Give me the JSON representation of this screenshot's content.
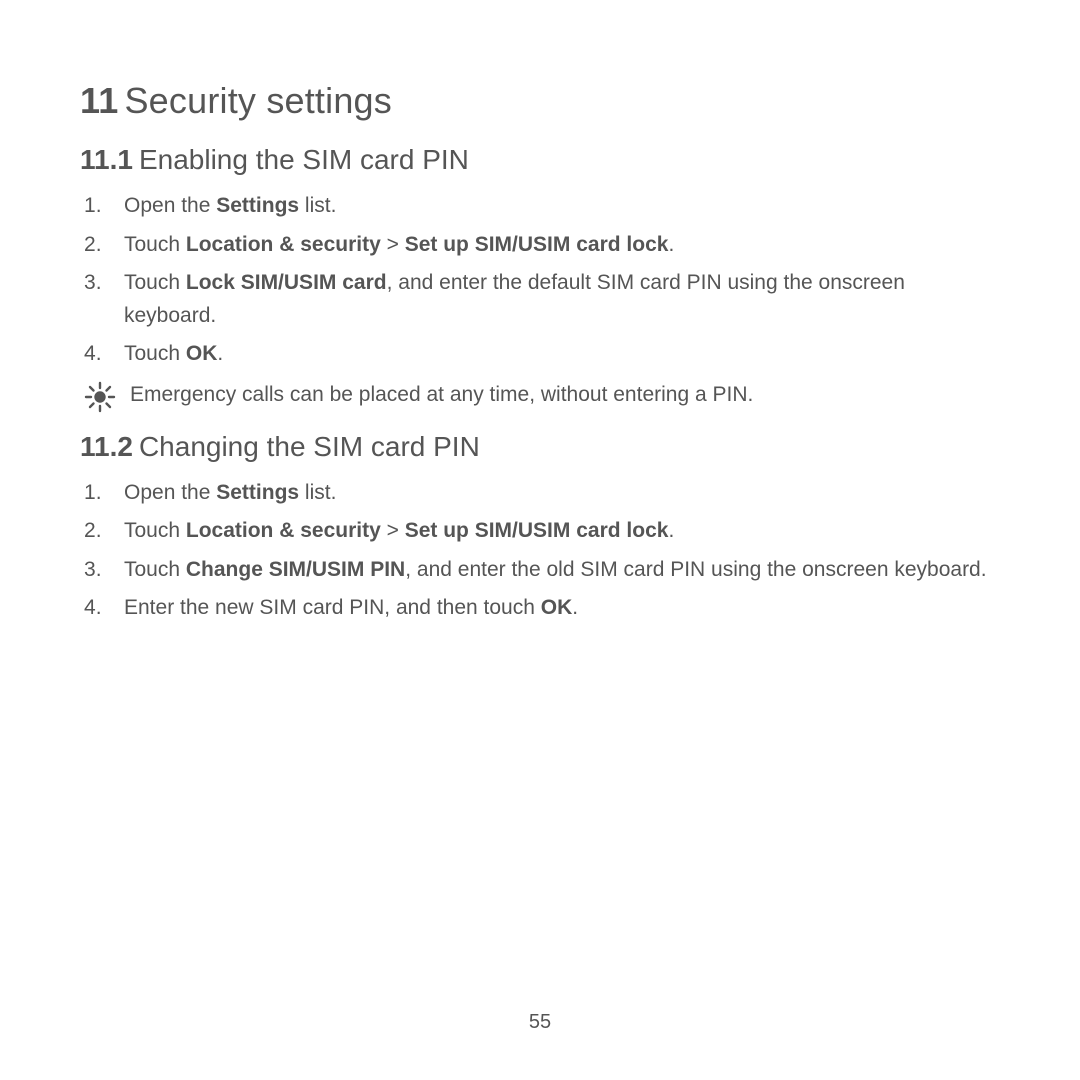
{
  "chapter": {
    "number": "11",
    "title": "Security settings"
  },
  "section1": {
    "number": "11.1",
    "title": "Enabling the SIM card PIN",
    "step1_a": "Open the ",
    "step1_b": "Settings",
    "step1_c": " list.",
    "step2_a": "Touch ",
    "step2_b": "Location & security",
    "step2_c": " > ",
    "step2_d": "Set up SIM/USIM card lock",
    "step2_e": ".",
    "step3_a": "Touch ",
    "step3_b": "Lock SIM/USIM card",
    "step3_c": ", and enter the default SIM card PIN using the onscreen keyboard.",
    "step4_a": "Touch ",
    "step4_b": "OK",
    "step4_c": ".",
    "note": "Emergency calls can be placed at any time, without entering a PIN."
  },
  "section2": {
    "number": "11.2",
    "title": "Changing the SIM card PIN",
    "step1_a": "Open the ",
    "step1_b": "Settings",
    "step1_c": " list.",
    "step2_a": "Touch ",
    "step2_b": "Location & security",
    "step2_c": " > ",
    "step2_d": "Set up SIM/USIM card lock",
    "step2_e": ".",
    "step3_a": "Touch ",
    "step3_b": "Change SIM/USIM PIN",
    "step3_c": ", and enter the old SIM card PIN using the onscreen keyboard.",
    "step4_a": "Enter the new SIM card PIN, and then touch ",
    "step4_b": "OK",
    "step4_c": "."
  },
  "page_number": "55"
}
